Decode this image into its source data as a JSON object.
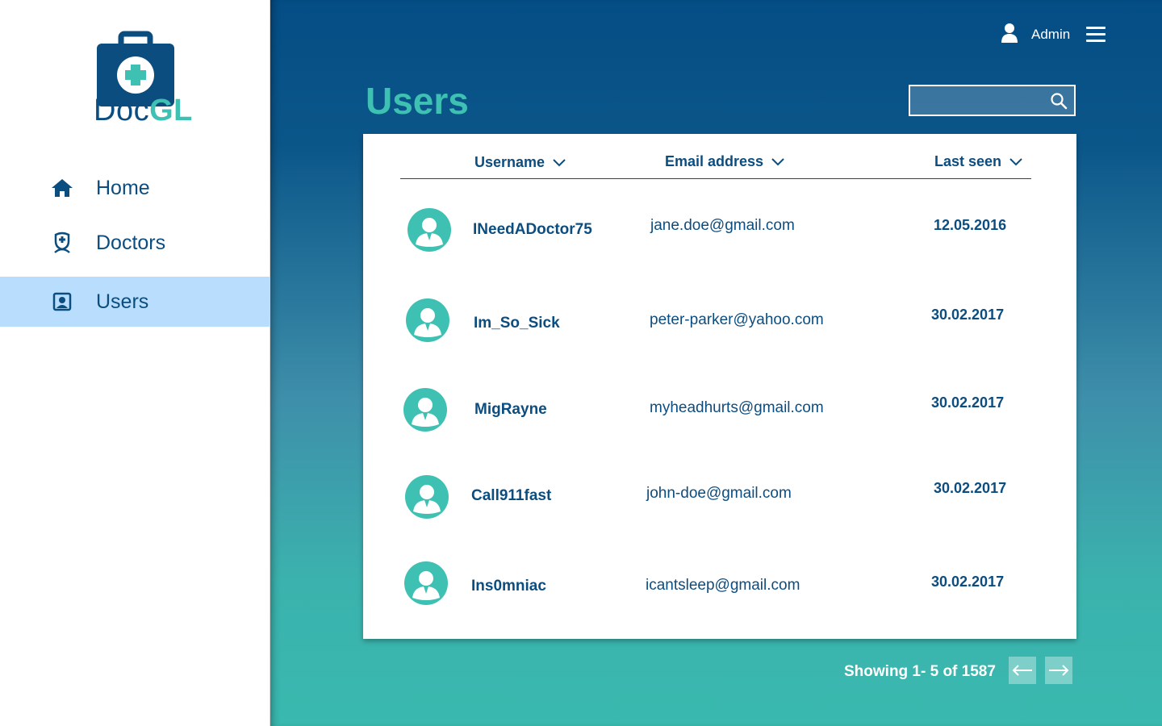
{
  "app": {
    "logo_text_main": "Doc",
    "logo_text_accent": "GL"
  },
  "sidebar": {
    "items": [
      {
        "label": "Home",
        "icon": "home-icon",
        "active": false
      },
      {
        "label": "Doctors",
        "icon": "doctor-icon",
        "active": false
      },
      {
        "label": "Users",
        "icon": "user-card-icon",
        "active": true
      }
    ]
  },
  "topbar": {
    "user_label": "Admin"
  },
  "page": {
    "title": "Users"
  },
  "search": {
    "value": "",
    "placeholder": ""
  },
  "table": {
    "columns": [
      "Username",
      "Email address",
      "Last seen"
    ],
    "rows": [
      {
        "username": "INeedADoctor75",
        "email": "jane.doe@gmail.com",
        "last_seen": "12.05.2016"
      },
      {
        "username": "Im_So_Sick",
        "email": "peter-parker@yahoo.com",
        "last_seen": "30.02.2017"
      },
      {
        "username": "MigRayne",
        "email": "myheadhurts@gmail.com",
        "last_seen": "30.02.2017"
      },
      {
        "username": "Call911fast",
        "email": "john-doe@gmail.com",
        "last_seen": "30.02.2017"
      },
      {
        "username": "Ins0mniac",
        "email": "icantsleep@gmail.com",
        "last_seen": "30.02.2017"
      }
    ]
  },
  "pagination": {
    "summary": "Showing 1- 5 of 1587"
  },
  "colors": {
    "primary": "#0c4d80",
    "accent": "#3ec1b3",
    "active_nav": "#b9defd"
  }
}
